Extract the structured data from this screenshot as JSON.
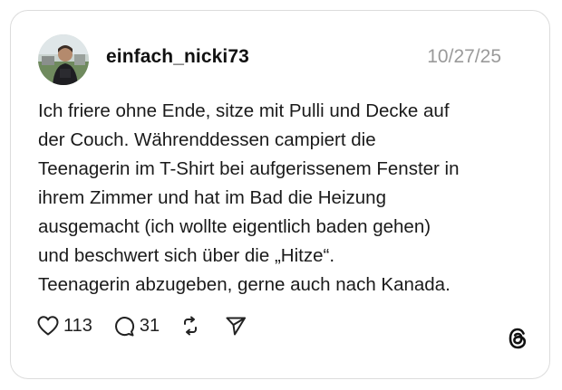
{
  "post": {
    "username": "einfach_nicki73",
    "date": "10/27/25",
    "text": "Ich friere ohne Ende, sitze mit Pulli und Decke auf\nder Couch. Währenddessen campiert die\nTeenagerin im T-Shirt bei aufgerissenem Fenster in\nihrem Zimmer und hat im Bad die Heizung\nausgemacht (ich wollte eigentlich baden gehen)\nund beschwert sich über die „Hitze“.\nTeenagerin abzugeben, gerne auch nach Kanada."
  },
  "actions": {
    "like_count": "113",
    "reply_count": "31"
  },
  "icons": {
    "like": "heart-icon",
    "reply": "comment-icon",
    "repost": "repost-icon",
    "share": "send-icon",
    "brand": "threads-logo-icon"
  }
}
